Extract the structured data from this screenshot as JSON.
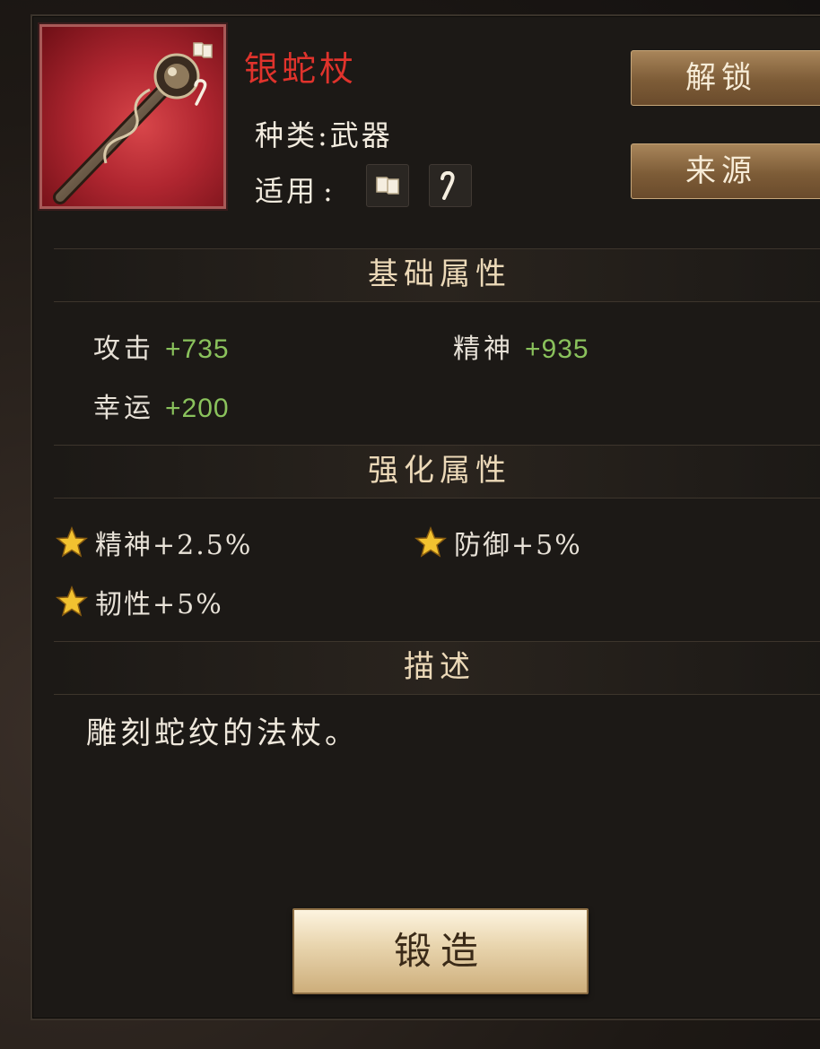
{
  "item": {
    "name": "银蛇杖",
    "type_label": "种类",
    "type_sep": ":",
    "type_value": "武器",
    "apply_label": "适用",
    "apply_sep": ":",
    "apply_icons": [
      "scroll-icon",
      "hook-staff-icon"
    ]
  },
  "buttons": {
    "unlock": "解锁",
    "source": "来源",
    "forge": "锻造"
  },
  "sections": {
    "base": "基础属性",
    "enhance": "强化属性",
    "description": "描述"
  },
  "base_stats": [
    {
      "label": "攻击",
      "value": "+735"
    },
    {
      "label": "精神",
      "value": "+935"
    },
    {
      "label": "幸运",
      "value": "+200"
    }
  ],
  "enhance_stats": [
    {
      "text": "精神+2.5%"
    },
    {
      "text": "防御+5%"
    },
    {
      "text": "韧性+5%"
    }
  ],
  "description": "雕刻蛇纹的法杖。",
  "colors": {
    "name": "#e0332c",
    "stat_value": "#8ac25c",
    "frame": "#a85a58",
    "button": "#7d5c37"
  }
}
